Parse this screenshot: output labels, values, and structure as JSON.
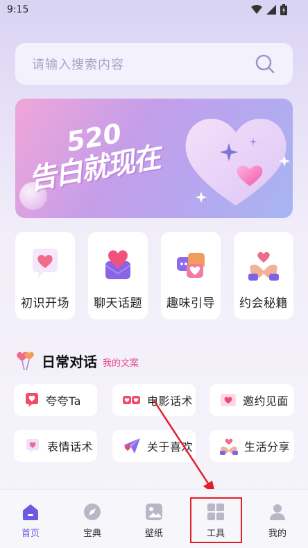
{
  "status_bar": {
    "time": "9:15"
  },
  "search": {
    "placeholder": "请输入搜索内容"
  },
  "banner": {
    "number": "520",
    "text": "告白就现在"
  },
  "cards": [
    {
      "label": "初识开场",
      "icon": "speech-heart-icon"
    },
    {
      "label": "聊天话题",
      "icon": "envelope-heart-icon"
    },
    {
      "label": "趣味引导",
      "icon": "chat-bubbles-heart-icon"
    },
    {
      "label": "约会秘籍",
      "icon": "hands-heart-icon"
    }
  ],
  "section": {
    "title": "日常对话",
    "link": "我的文案"
  },
  "chips": [
    {
      "label": "夸夸Ta",
      "icon": "heart-bubble-icon"
    },
    {
      "label": "电影话术",
      "icon": "movie-hearts-icon"
    },
    {
      "label": "邀约见面",
      "icon": "card-heart-icon"
    },
    {
      "label": "表情话术",
      "icon": "emoji-heart-icon"
    },
    {
      "label": "关于喜欢",
      "icon": "paper-plane-heart-icon"
    },
    {
      "label": "生活分享",
      "icon": "share-hands-icon"
    }
  ],
  "tabs": [
    {
      "label": "首页",
      "icon": "home-icon",
      "active": true
    },
    {
      "label": "宝典",
      "icon": "compass-icon",
      "active": false
    },
    {
      "label": "壁纸",
      "icon": "image-icon",
      "active": false
    },
    {
      "label": "工具",
      "icon": "grid-icon",
      "active": false
    },
    {
      "label": "我的",
      "icon": "user-icon",
      "active": false
    }
  ],
  "colors": {
    "accent": "#6a5ce0",
    "link": "#e8458b",
    "highlight": "#e21f26"
  }
}
